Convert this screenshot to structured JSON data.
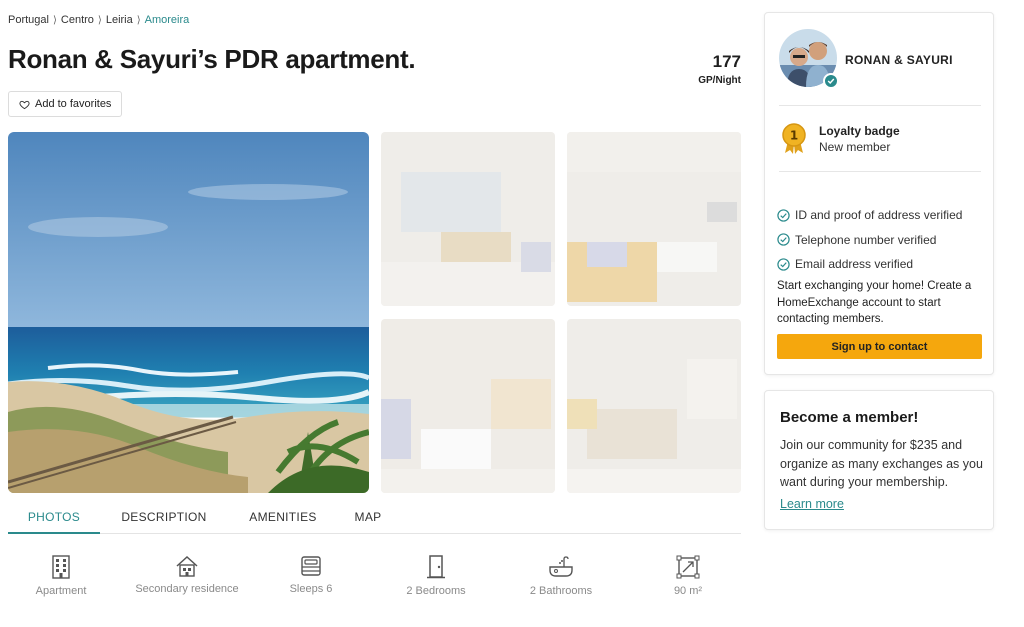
{
  "breadcrumb": {
    "items": [
      "Portugal",
      "Centro",
      "Leiria"
    ],
    "separator": "⟩",
    "current": "Amoreira"
  },
  "listing": {
    "title": "Ronan & Sayuri’s PDR apartment.",
    "price_amount": "177",
    "price_unit": "GP/Night",
    "favorite_label": "Add to favorites"
  },
  "tabs": [
    {
      "label": "PHOTOS",
      "active": true
    },
    {
      "label": "DESCRIPTION",
      "active": false
    },
    {
      "label": "AMENITIES",
      "active": false
    },
    {
      "label": "MAP",
      "active": false
    }
  ],
  "features": [
    {
      "icon": "apartment-icon",
      "label": "Apartment"
    },
    {
      "icon": "house-icon",
      "label": "Secondary residence"
    },
    {
      "icon": "bed-icon",
      "label": "Sleeps 6"
    },
    {
      "icon": "door-icon",
      "label": "2 Bedrooms"
    },
    {
      "icon": "bathtub-icon",
      "label": "2 Bathrooms"
    },
    {
      "icon": "area-icon",
      "label": "90 m²"
    }
  ],
  "host": {
    "name": "RONAN & SAYURI",
    "badge_title": "Loyalty badge",
    "badge_subtitle": "New member",
    "verifications": [
      "ID and proof of address verified",
      "Telephone number verified",
      "Email address verified"
    ],
    "cta_text": "Start exchanging your home! Create a HomeExchange account to start contacting members.",
    "signup_label": "Sign up to contact"
  },
  "membership": {
    "title": "Become a member!",
    "text": "Join our community for $235 and organize as many exchanges as you want during your membership.",
    "link_label": "Learn more"
  },
  "colors": {
    "accent": "#2a8a8c",
    "cta": "#f5a70d",
    "badge": "#f0b323"
  }
}
